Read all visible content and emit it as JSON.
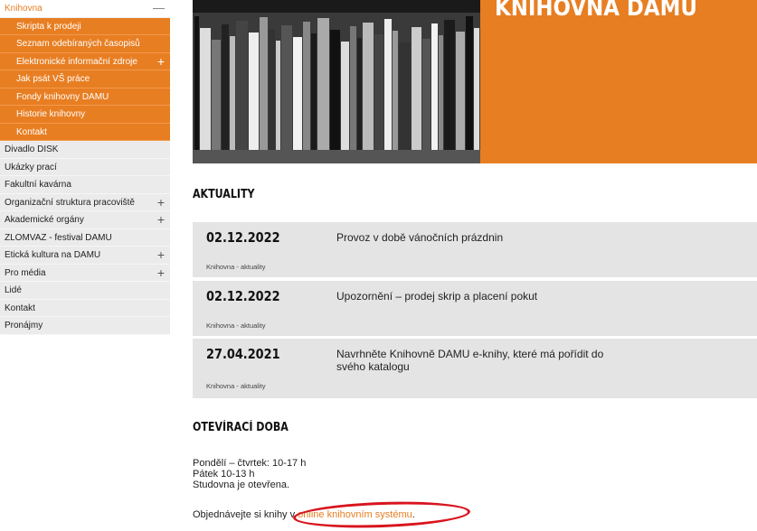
{
  "sidebar": {
    "items": [
      {
        "label": "Knihovna",
        "toggle": "—",
        "kind": "top"
      },
      {
        "label": "Skripta k prodeji",
        "kind": "sub"
      },
      {
        "label": "Seznam odebíraných časopisů",
        "kind": "sub"
      },
      {
        "label": "Elektronické informační zdroje",
        "toggle": "+",
        "kind": "sub"
      },
      {
        "label": "Jak psát VŠ práce",
        "kind": "sub"
      },
      {
        "label": "Fondy knihovny DAMU",
        "kind": "sub"
      },
      {
        "label": "Historie knihovny",
        "kind": "sub"
      },
      {
        "label": "Kontakt",
        "kind": "sub"
      },
      {
        "label": "Divadlo DISK",
        "kind": "gray"
      },
      {
        "label": "Ukázky prací",
        "kind": "gray"
      },
      {
        "label": "Fakultní kavárna",
        "kind": "gray"
      },
      {
        "label": "Organizační struktura pracoviště",
        "toggle": "+",
        "kind": "gray"
      },
      {
        "label": "Akademické orgány",
        "toggle": "+",
        "kind": "gray"
      },
      {
        "label": "ZLOMVAZ - festival DAMU",
        "kind": "gray"
      },
      {
        "label": "Etická kultura na DAMU",
        "toggle": "+",
        "kind": "gray"
      },
      {
        "label": "Pro média",
        "toggle": "+",
        "kind": "gray"
      },
      {
        "label": "Lidé",
        "kind": "gray"
      },
      {
        "label": "Kontakt",
        "kind": "gray"
      },
      {
        "label": "Pronájmy",
        "kind": "gray"
      }
    ]
  },
  "hero": {
    "title": "KNIHOVNA DAMU"
  },
  "news_section": {
    "title": "AKTUALITY"
  },
  "news": [
    {
      "date": "02.12.2022",
      "title": "Provoz v době vánočních prázdnin",
      "category": "Knihovna - aktuality"
    },
    {
      "date": "02.12.2022",
      "title": "Upozornění – prodej skrip a placení pokut",
      "category": "Knihovna - aktuality"
    },
    {
      "date": "27.04.2021",
      "title": "Navrhněte Knihovně DAMU e-knihy, které má pořídit do svého katalogu",
      "category": "Knihovna - aktuality"
    }
  ],
  "hours_section": {
    "title": "OTEVÍRACÍ DOBA"
  },
  "hours": {
    "line1": "Pondělí – čtvrtek: 10-17 h",
    "line2": "Pátek 10-13 h",
    "line3": "Studovna je otevřena."
  },
  "order": {
    "prefix": "Objednávejte si knihy v ",
    "link": "online knihovním systému",
    "suffix": "."
  },
  "colors": {
    "accent": "#e87e22",
    "annotation": "#d9141e"
  }
}
